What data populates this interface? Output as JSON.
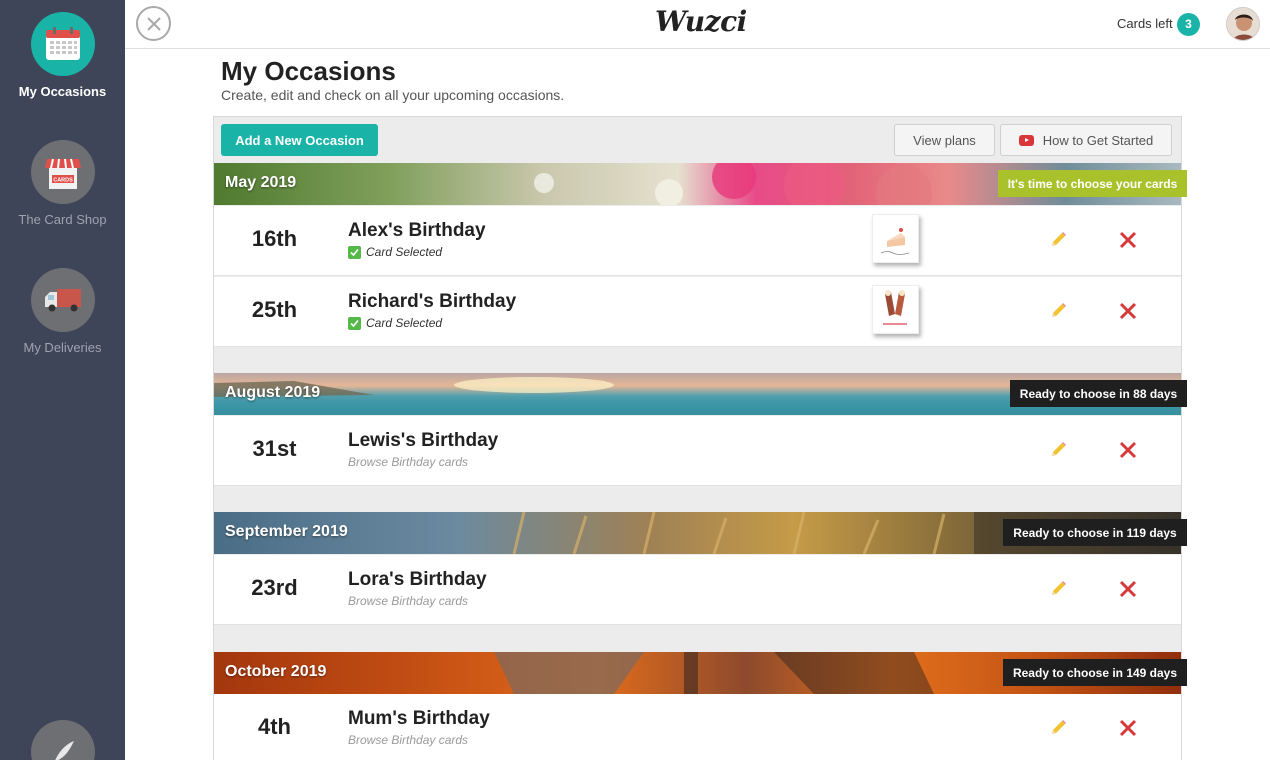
{
  "app": {
    "logo": "Wuzci",
    "cards_left_label": "Cards left",
    "cards_left_count": "3",
    "accent_color": "#19b3a8"
  },
  "sidebar": {
    "items": [
      {
        "label": "My Occasions",
        "icon": "calendar-icon",
        "active": true
      },
      {
        "label": "The Card Shop",
        "icon": "shop-icon",
        "active": false
      },
      {
        "label": "My Deliveries",
        "icon": "truck-icon",
        "active": false
      }
    ]
  },
  "page": {
    "title": "My Occasions",
    "subtitle": "Create, edit and check on all your upcoming occasions."
  },
  "toolbar": {
    "add_label": "Add a New Occasion",
    "plans_label": "View plans",
    "howto_label": "How to Get Started"
  },
  "months": [
    {
      "name": "May 2019",
      "badge": "It's time to choose your cards",
      "badge_color": "#a9c12b",
      "occasions": [
        {
          "date": "16th",
          "name": "Alex's Birthday",
          "status": "Card Selected",
          "card_selected": true
        },
        {
          "date": "25th",
          "name": "Richard's Birthday",
          "status": "Card Selected",
          "card_selected": true
        }
      ]
    },
    {
      "name": "August 2019",
      "badge": "Ready to choose in 88 days",
      "badge_color": "#1f1f1f",
      "occasions": [
        {
          "date": "31st",
          "name": "Lewis's Birthday",
          "status": "Browse Birthday cards",
          "card_selected": false
        }
      ]
    },
    {
      "name": "September 2019",
      "badge": "Ready to choose in 119 days",
      "badge_color": "#1f1f1f",
      "occasions": [
        {
          "date": "23rd",
          "name": "Lora's Birthday",
          "status": "Browse Birthday cards",
          "card_selected": false
        }
      ]
    },
    {
      "name": "October 2019",
      "badge": "Ready to choose in 149 days",
      "badge_color": "#1f1f1f",
      "occasions": [
        {
          "date": "4th",
          "name": "Mum's Birthday",
          "status": "Browse Birthday cards",
          "card_selected": false
        }
      ]
    }
  ]
}
